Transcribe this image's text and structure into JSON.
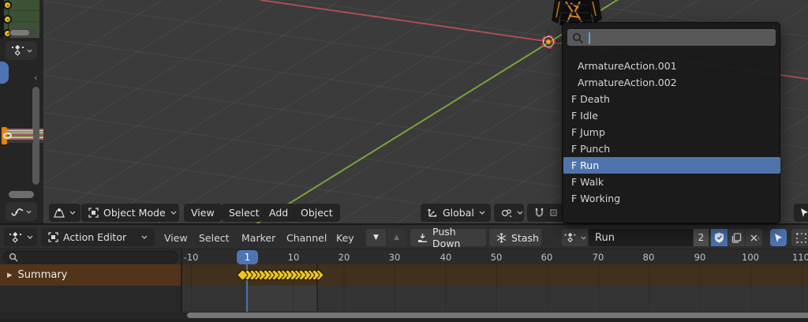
{
  "colors": {
    "accent_blue": "#4f74b3",
    "selection_highlight": "#4e74ab",
    "keyframe_yellow": "#eec51f",
    "summary_channel_bg": "#513419",
    "viewport_bg": "#3b3b3b",
    "axis_red": "#a84e56",
    "axis_green": "#79a13f",
    "fake_user_shield_bg": "#4a72b0"
  },
  "viewport": {
    "footer": {
      "mode": "Object Mode",
      "menus": [
        "View",
        "Select",
        "Add",
        "Object"
      ],
      "orientation": "Global"
    }
  },
  "action_popup": {
    "search_value": "",
    "items": [
      "ArmatureAction.001",
      "ArmatureAction.002",
      "F Death",
      "F Idle",
      "F Jump",
      "F Punch",
      "F Run",
      "F Walk",
      "F Working"
    ],
    "selected_item": "F Run"
  },
  "dope_sheet": {
    "editor_type": "Action Editor",
    "menus": [
      "View",
      "Select",
      "Marker",
      "Channel",
      "Key"
    ],
    "push_down_label": "Push Down",
    "stash_label": "Stash",
    "action_name": "Run",
    "user_count": "2",
    "current_frame": "1",
    "ruler_ticks": [
      "-10",
      "10",
      "20",
      "30",
      "40",
      "50",
      "60",
      "70",
      "80",
      "90",
      "100",
      "110"
    ],
    "channels": [
      {
        "label": "Summary",
        "keyframe_range": {
          "start": 1,
          "end": 15,
          "count": 18
        }
      }
    ]
  },
  "icons": {
    "search": "magnifier-glyph",
    "dope_sheet_editor": "diamond-keys-glyph",
    "graph_editor": "curve-glyph",
    "object_mode": "bracketed-square-glyph",
    "orientation_global": "axes-glyph",
    "pivot_point": "two-circles-glyph",
    "snap_magnet": "magnet-glyph",
    "fake_user": "shield-check-glyph",
    "duplicate": "copy-pages-glyph",
    "unlink": "x-glyph",
    "gizmo_cursor": "arrow-cursor-glyph",
    "push_down": "tray-arrow-glyph",
    "stash": "snowflake-glyph"
  }
}
